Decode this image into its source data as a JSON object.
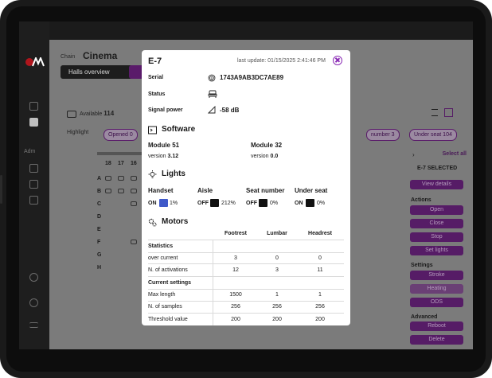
{
  "background_app": {
    "chain_label": "Chain",
    "chain_name": "Cinema",
    "tab_halls_overview": "Halls overview",
    "available_label": "Available",
    "available_count": "114",
    "highlight_label": "Highlight",
    "highlight_chip_opened": "Opened 0",
    "highlight_chip_number": "number 3",
    "highlight_chip_under_seat": "Under seat 104",
    "nav_section_label": "Adm",
    "columns": [
      "18",
      "17",
      "16"
    ],
    "rows": [
      "A",
      "B",
      "C",
      "D",
      "E",
      "F",
      "G",
      "H"
    ],
    "right_panel": {
      "select_all": "Select all",
      "selected_label": "E-7 SELECTED",
      "view_details": "View details",
      "actions_label": "Actions",
      "action_buttons": [
        "Open",
        "Close",
        "Stop",
        "Set lights"
      ],
      "settings_label": "Settings",
      "settings_buttons": [
        "Stroke",
        "Heating",
        "ODS"
      ],
      "advanced_label": "Advanced",
      "advanced_buttons": [
        "Reboot",
        "Delete"
      ]
    }
  },
  "modal": {
    "title": "E-7",
    "last_update": "last update: 01/15/2025 2:41:46 PM",
    "serial_label": "Serial",
    "serial_value": "1743A9AB3DC7AE89",
    "status_label": "Status",
    "signal_label": "Signal power",
    "signal_value": "-58 dB",
    "software": {
      "title": "Software",
      "modules": [
        {
          "name": "Module 51",
          "version_label": "version",
          "version": "3.12"
        },
        {
          "name": "Module 32",
          "version_label": "version",
          "version": "0.0"
        }
      ]
    },
    "lights": {
      "title": "Lights",
      "items": [
        {
          "name": "Handset",
          "state": "ON",
          "color": "#3f59c9",
          "value": "1%"
        },
        {
          "name": "Aisle",
          "state": "OFF",
          "color": "#111111",
          "value": "212%"
        },
        {
          "name": "Seat number",
          "state": "OFF",
          "color": "#111111",
          "value": "0%"
        },
        {
          "name": "Under seat",
          "state": "ON",
          "color": "#111111",
          "value": "0%"
        }
      ]
    },
    "motors": {
      "title": "Motors",
      "columns": [
        "Footrest",
        "Lumbar",
        "Headrest"
      ],
      "statistics_label": "Statistics",
      "statistics_rows": [
        {
          "label": "over current",
          "values": [
            "3",
            "0",
            "0"
          ]
        },
        {
          "label": "N. of activations",
          "values": [
            "12",
            "3",
            "11"
          ]
        }
      ],
      "current_settings_label": "Current settings",
      "settings_rows": [
        {
          "label": "Max length",
          "values": [
            "1500",
            "1",
            "1"
          ]
        },
        {
          "label": "N. of samples",
          "values": [
            "256",
            "256",
            "256"
          ]
        },
        {
          "label": "Threshold value",
          "values": [
            "200",
            "200",
            "200"
          ]
        }
      ]
    }
  },
  "colors": {
    "accent_purple": "#8a2ab5",
    "button_purple": "#561c66"
  }
}
